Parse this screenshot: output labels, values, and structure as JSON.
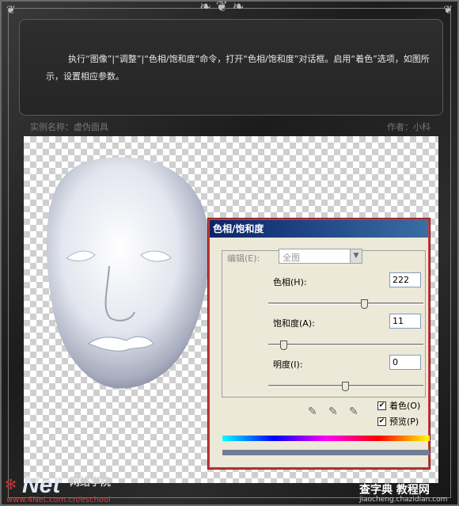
{
  "intro_text": "执行“图像”|“调整”|“色相/饱和度”命令，打开“色相/饱和度”对话框。启用“着色”选项，如图所示，设置相应参数。",
  "meta": {
    "example_name": "实例名称：虚伪面具",
    "author": "作者：小科"
  },
  "dialog": {
    "title": "色相/饱和度",
    "edit_label": "编辑(E):",
    "edit_value": "全图",
    "hue_label": "色相(H):",
    "hue_value": "222",
    "saturation_label": "饱和度(A):",
    "saturation_value": "11",
    "lightness_label": "明度(I):",
    "lightness_value": "0",
    "colorize_label": "着色(O)",
    "preview_label": "预览(P)",
    "hue_slider": 0.62,
    "saturation_slider": 0.1,
    "lightness_slider": 0.5
  },
  "logo": {
    "mark": "Net",
    "cn_name": "网络学院",
    "url": "www.4Net.com.cn/eschool"
  },
  "watermark": {
    "line1": "查字典 教程网",
    "line2": "jiaocheng.chazidian.com"
  }
}
